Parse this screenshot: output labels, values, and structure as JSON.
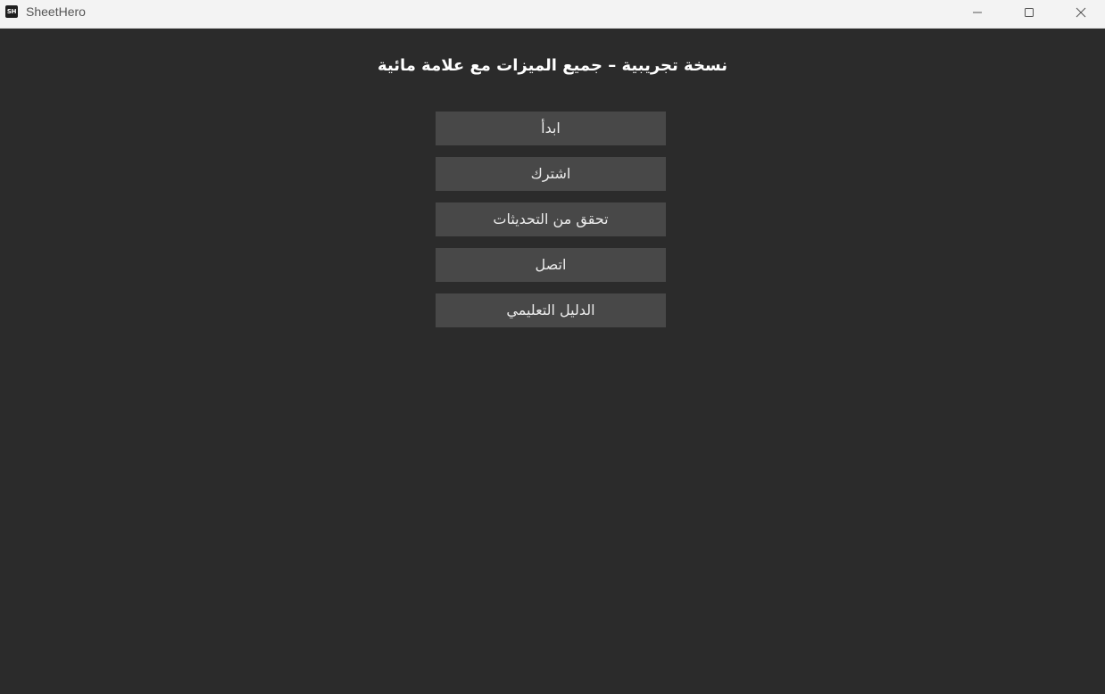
{
  "window": {
    "app_icon_text": "SH",
    "title": "SheetHero",
    "controls": [
      "minimize",
      "maximize",
      "close"
    ]
  },
  "main": {
    "headline": "نسخة تجريبية – جميع الميزات مع علامة مائية",
    "buttons": [
      {
        "label": "ابدأ"
      },
      {
        "label": "اشترك"
      },
      {
        "label": "تحقق من التحديثات"
      },
      {
        "label": "اتصل"
      },
      {
        "label": "الدليل التعليمي"
      }
    ]
  },
  "colors": {
    "background": "#2b2b2b",
    "button": "#484848",
    "button_text": "#ececec",
    "titlebar": "#f3f3f3"
  }
}
